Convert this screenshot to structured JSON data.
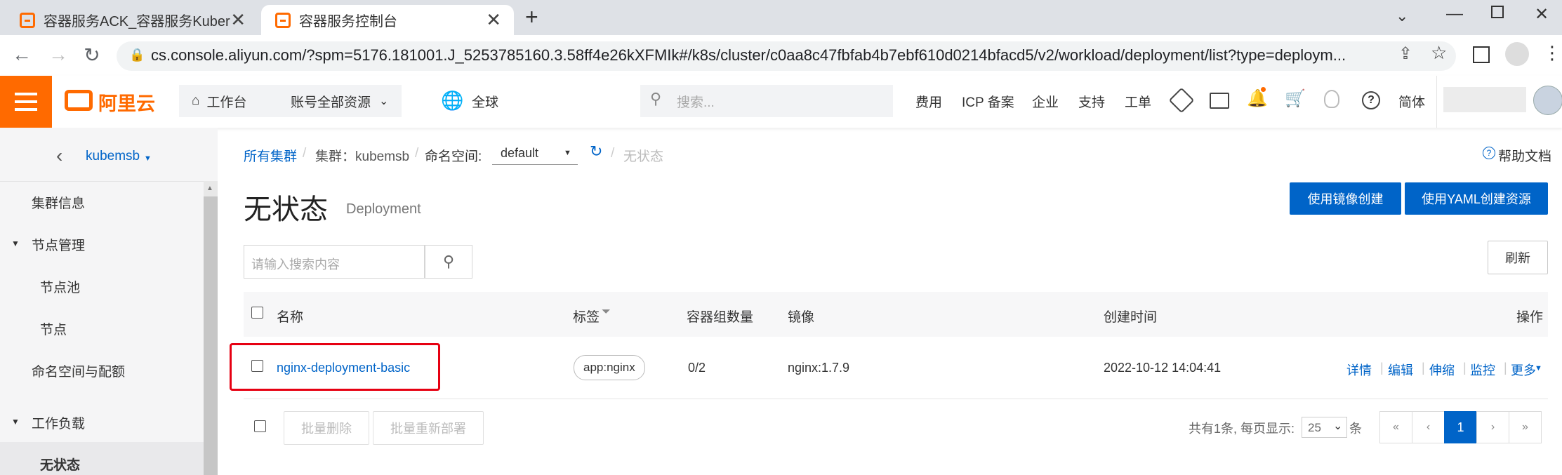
{
  "browser": {
    "tabs": [
      {
        "title": "容器服务ACK_容器服务Kubernetes版",
        "active": false
      },
      {
        "title": "容器服务控制台",
        "active": true
      }
    ],
    "new_tab": "+",
    "url": "cs.console.aliyun.com/?spm=5176.181001.J_5253785160.3.58ff4e26kXFMIk#/k8s/cluster/c0aa8c47fbfab4b7ebf610d0214bfacd5/v2/workload/deployment/list?type=deploym..."
  },
  "header": {
    "logo_text": "阿里云",
    "workbench": "工作台",
    "account_resources": "账号全部资源",
    "region": "全球",
    "search_placeholder": "搜索...",
    "nav": [
      "费用",
      "ICP 备案",
      "企业",
      "支持",
      "工单"
    ],
    "language": "简体"
  },
  "sidebar": {
    "cluster_name": "kubemsb",
    "items": [
      {
        "label": "集群信息"
      },
      {
        "label": "节点管理"
      },
      {
        "label": "节点池"
      },
      {
        "label": "节点"
      },
      {
        "label": "命名空间与配额"
      },
      {
        "label": "工作负载"
      },
      {
        "label": "无状态"
      }
    ]
  },
  "breadcrumb": {
    "all_clusters": "所有集群",
    "cluster_label": "集群：kubemsb",
    "namespace_label": "命名空间:",
    "namespace_value": "default",
    "current": "无状态",
    "sep": "/"
  },
  "help": "帮助文档",
  "page": {
    "title": "无状态",
    "subtitle": "Deployment",
    "btn_image_create": "使用镜像创建",
    "btn_yaml_create": "使用YAML创建资源",
    "search_placeholder": "请输入搜索内容",
    "refresh": "刷新"
  },
  "table": {
    "headers": {
      "name": "名称",
      "labels": "标签",
      "pods": "容器组数量",
      "image": "镜像",
      "created": "创建时间",
      "actions": "操作"
    },
    "rows": [
      {
        "name": "nginx-deployment-basic",
        "label": "app:nginx",
        "pods": "0/2",
        "image": "nginx:1.7.9",
        "created": "2022-10-12 14:04:41",
        "actions": [
          "详情",
          "编辑",
          "伸缩",
          "监控",
          "更多"
        ]
      }
    ]
  },
  "footer": {
    "batch_delete": "批量删除",
    "batch_redeploy": "批量重新部署",
    "total_text": "共有1条, 每页显示:",
    "page_size": "25",
    "unit": "条",
    "pages": [
      "«",
      "‹",
      "1",
      "›",
      "»"
    ]
  },
  "colors": {
    "accent": "#ff6a00",
    "primary": "#0064c8",
    "highlight_box": "#e60012"
  }
}
